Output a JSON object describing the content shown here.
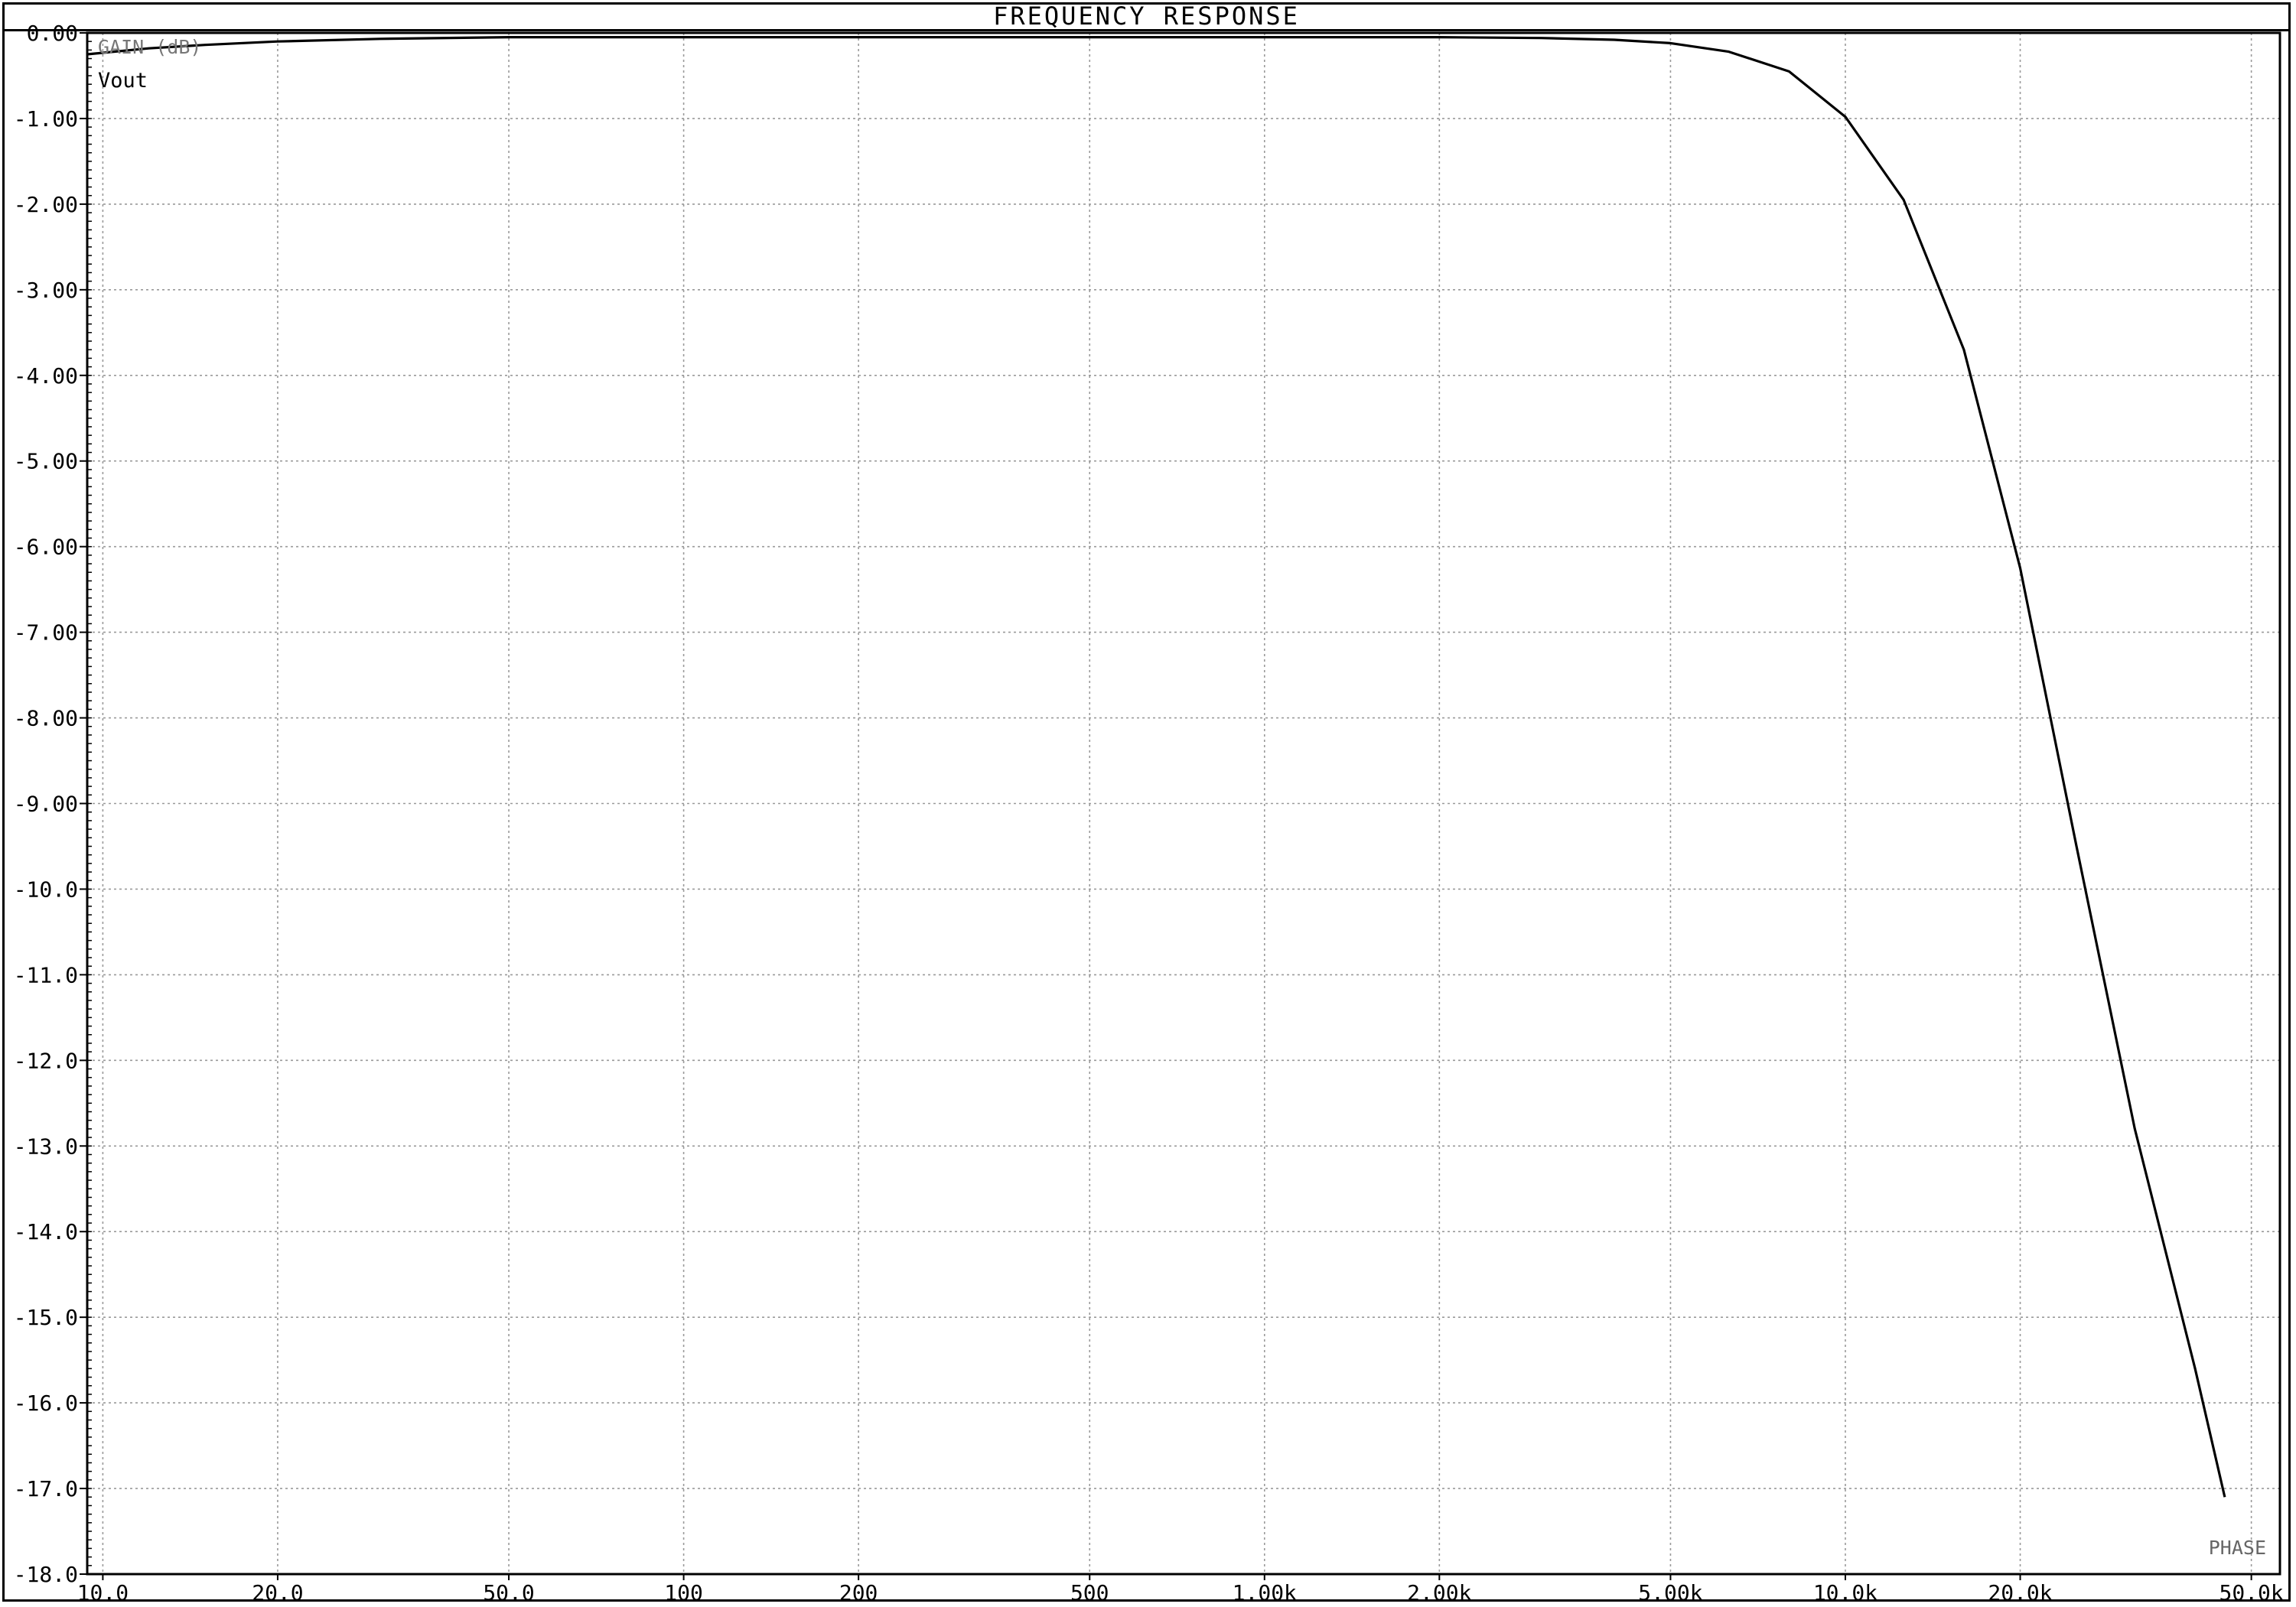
{
  "chart_data": {
    "type": "line",
    "title": "FREQUENCY RESPONSE",
    "ylabel": "GAIN (dB)",
    "xlabel": "",
    "corner_label": "PHASE",
    "x_scale": "log",
    "xlim": [
      9.4,
      56000
    ],
    "ylim": [
      -18,
      0
    ],
    "grid": true,
    "x_ticks": [
      {
        "value": 10,
        "label": "10.0"
      },
      {
        "value": 20,
        "label": "20.0"
      },
      {
        "value": 50,
        "label": "50.0"
      },
      {
        "value": 100,
        "label": "100"
      },
      {
        "value": 200,
        "label": "200"
      },
      {
        "value": 500,
        "label": "500"
      },
      {
        "value": 1000,
        "label": "1.00k"
      },
      {
        "value": 2000,
        "label": "2.00k"
      },
      {
        "value": 5000,
        "label": "5.00k"
      },
      {
        "value": 10000,
        "label": "10.0k"
      },
      {
        "value": 20000,
        "label": "20.0k"
      },
      {
        "value": 50000,
        "label": "50.0k"
      }
    ],
    "y_ticks": [
      {
        "value": 0,
        "label": "0.00"
      },
      {
        "value": -1,
        "label": "-1.00"
      },
      {
        "value": -2,
        "label": "-2.00"
      },
      {
        "value": -3,
        "label": "-3.00"
      },
      {
        "value": -4,
        "label": "-4.00"
      },
      {
        "value": -5,
        "label": "-5.00"
      },
      {
        "value": -6,
        "label": "-6.00"
      },
      {
        "value": -7,
        "label": "-7.00"
      },
      {
        "value": -8,
        "label": "-8.00"
      },
      {
        "value": -9,
        "label": "-9.00"
      },
      {
        "value": -10,
        "label": "-10.0"
      },
      {
        "value": -11,
        "label": "-11.0"
      },
      {
        "value": -12,
        "label": "-12.0"
      },
      {
        "value": -13,
        "label": "-13.0"
      },
      {
        "value": -14,
        "label": "-14.0"
      },
      {
        "value": -15,
        "label": "-15.0"
      },
      {
        "value": -16,
        "label": "-16.0"
      },
      {
        "value": -17,
        "label": "-17.0"
      },
      {
        "value": -18,
        "label": "-18.0"
      }
    ],
    "series": [
      {
        "name": "Vout",
        "x": [
          9.4,
          12,
          15,
          20,
          30,
          50,
          100,
          200,
          500,
          1000,
          2000,
          3000,
          4000,
          5000,
          6300,
          8000,
          10000,
          12600,
          16000,
          20000,
          25000,
          31500,
          40000,
          45000
        ],
        "y": [
          -0.25,
          -0.18,
          -0.14,
          -0.1,
          -0.07,
          -0.05,
          -0.05,
          -0.05,
          -0.05,
          -0.05,
          -0.05,
          -0.06,
          -0.08,
          -0.12,
          -0.22,
          -0.45,
          -0.98,
          -1.95,
          -3.7,
          -6.25,
          -9.5,
          -12.8,
          -15.6,
          -17.1
        ]
      }
    ],
    "colors": {
      "trace": "#000000",
      "grid": "#9a9a9a",
      "frame": "#000000"
    }
  }
}
